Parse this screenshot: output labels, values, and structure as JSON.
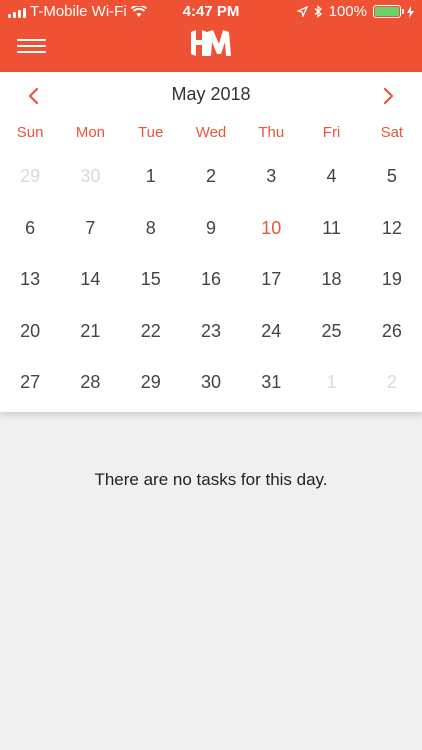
{
  "status_bar": {
    "carrier": "T-Mobile Wi-Fi",
    "time": "4:47 PM",
    "battery": "100%"
  },
  "header": {
    "logo_text": "HM"
  },
  "calendar": {
    "month_label": "May 2018",
    "weekdays": [
      "Sun",
      "Mon",
      "Tue",
      "Wed",
      "Thu",
      "Fri",
      "Sat"
    ],
    "weeks": [
      [
        {
          "d": "29",
          "m": true
        },
        {
          "d": "30",
          "m": true
        },
        {
          "d": "1"
        },
        {
          "d": "2"
        },
        {
          "d": "3"
        },
        {
          "d": "4"
        },
        {
          "d": "5"
        }
      ],
      [
        {
          "d": "6"
        },
        {
          "d": "7"
        },
        {
          "d": "8"
        },
        {
          "d": "9"
        },
        {
          "d": "10",
          "t": true
        },
        {
          "d": "11"
        },
        {
          "d": "12"
        }
      ],
      [
        {
          "d": "13"
        },
        {
          "d": "14"
        },
        {
          "d": "15"
        },
        {
          "d": "16"
        },
        {
          "d": "17"
        },
        {
          "d": "18"
        },
        {
          "d": "19"
        }
      ],
      [
        {
          "d": "20"
        },
        {
          "d": "21"
        },
        {
          "d": "22"
        },
        {
          "d": "23"
        },
        {
          "d": "24"
        },
        {
          "d": "25"
        },
        {
          "d": "26"
        }
      ],
      [
        {
          "d": "27"
        },
        {
          "d": "28"
        },
        {
          "d": "29"
        },
        {
          "d": "30"
        },
        {
          "d": "31"
        },
        {
          "d": "1",
          "m": true
        },
        {
          "d": "2",
          "m": true
        }
      ]
    ]
  },
  "tasks": {
    "empty_message": "There are no tasks for this day."
  },
  "colors": {
    "brand": "#ee5133",
    "accent": "#e8563a",
    "background": "#f0f0f0"
  },
  "icons": {
    "menu": "hamburger-icon",
    "prev": "chevron-left-icon",
    "next": "chevron-right-icon"
  }
}
